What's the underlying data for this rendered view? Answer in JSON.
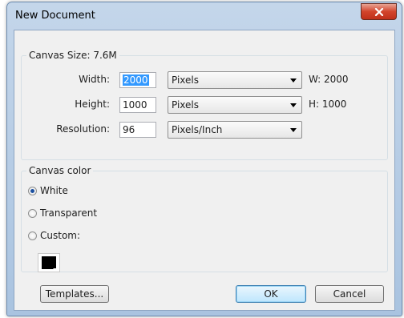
{
  "window": {
    "title": "New Document",
    "close_label": "x"
  },
  "canvas_size": {
    "legend": "Canvas Size: 7.6M",
    "width_label": "Width:",
    "width_value": "2000",
    "width_unit": "Pixels",
    "width_readout": "W: 2000",
    "height_label": "Height:",
    "height_value": "1000",
    "height_unit": "Pixels",
    "height_readout": "H: 1000",
    "resolution_label": "Resolution:",
    "resolution_value": "96",
    "resolution_unit": "Pixels/Inch"
  },
  "canvas_color": {
    "legend": "Canvas color",
    "options": [
      {
        "label": "White",
        "selected": true
      },
      {
        "label": "Transparent",
        "selected": false
      },
      {
        "label": "Custom:",
        "selected": false
      }
    ],
    "custom_color": "#000000"
  },
  "buttons": {
    "templates": "Templates...",
    "ok": "OK",
    "cancel": "Cancel"
  },
  "colors": {
    "accent_selection": "#3399ff",
    "close_button": "#c0301a"
  }
}
